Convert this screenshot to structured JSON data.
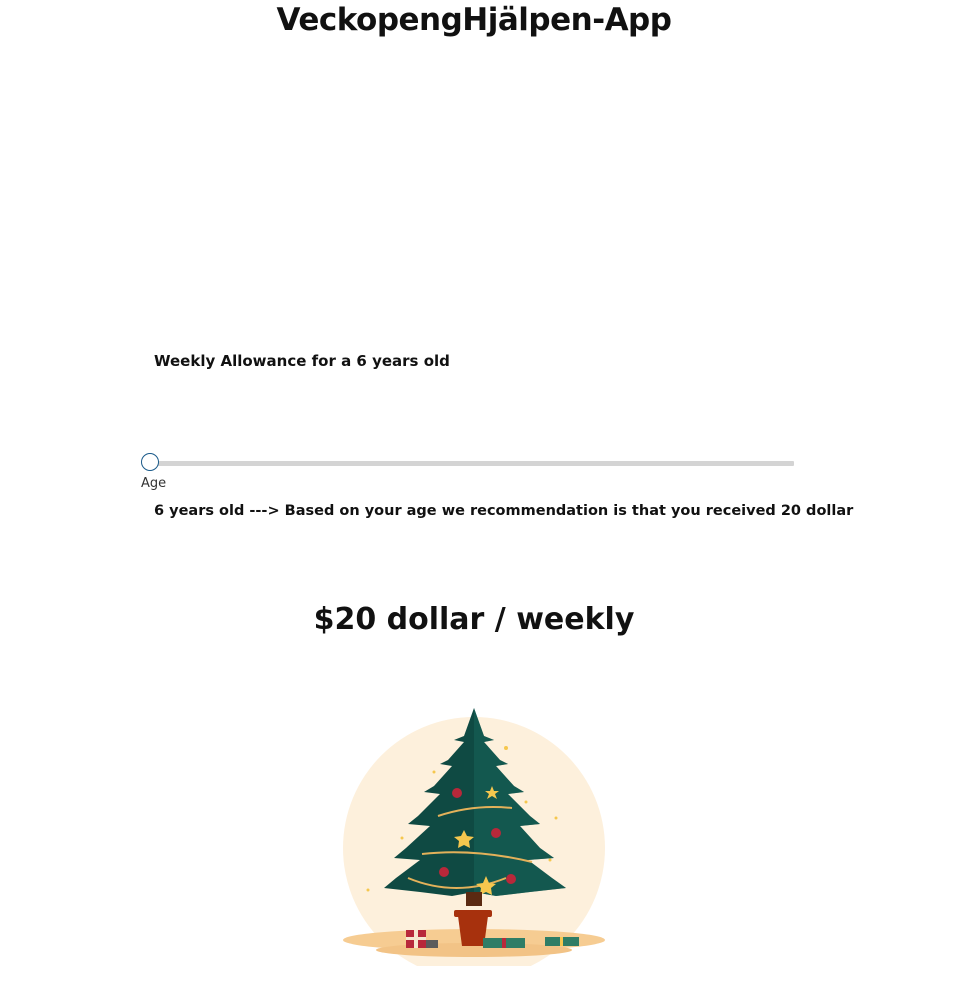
{
  "app": {
    "title": "VeckopengHjälpen-App"
  },
  "allowance": {
    "heading": "Weekly Allowance for a 6 years old",
    "slider": {
      "label": "Age",
      "value": 6,
      "fill_fraction": 0.0
    },
    "recommendation": "6 years old ---> Based on your age we recommendation is that you received 20 dollar",
    "amount_text": "$20 dollar / weekly"
  },
  "illustration": {
    "name": "christmas-tree-illustration",
    "colors": {
      "background_circle": "#fdf0dc",
      "tree": "#0f4a43",
      "tree_light": "#17655a",
      "pot": "#a7310d",
      "ornament": "#b8283a",
      "star": "#f5c74e",
      "ground": "#f6cc92"
    }
  },
  "colors": {
    "slider_track": "#d4d4d4",
    "slider_thumb_border": "#1a5a8a"
  }
}
